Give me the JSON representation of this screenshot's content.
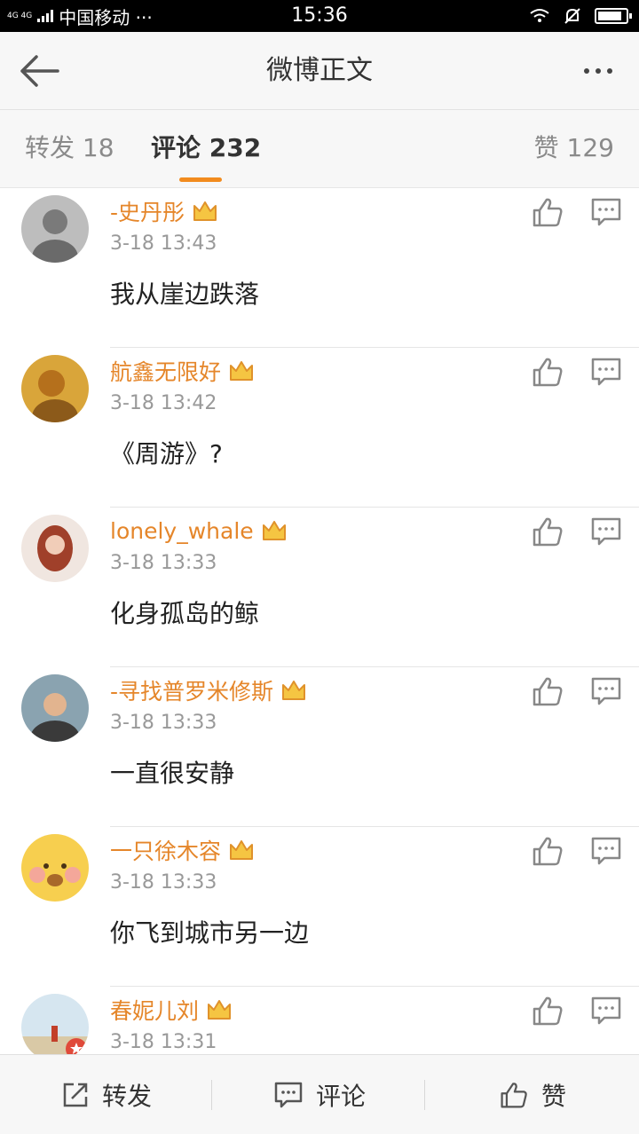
{
  "status_bar": {
    "network": "4G 4G",
    "carrier": "中国移动 ···",
    "time": "15:36",
    "battery_level": 0.85
  },
  "nav": {
    "title": "微博正文"
  },
  "tabs": {
    "repost": "转发 18",
    "comment": "评论 232",
    "like": "赞 129"
  },
  "comments": [
    {
      "user": "-史丹彤",
      "time": "3-18 13:43",
      "text": "我从崖边跌落",
      "avatar_icon": "user-avatar-icon"
    },
    {
      "user": "航鑫无限好",
      "time": "3-18 13:42",
      "text": "《周游》?",
      "avatar_icon": "user-avatar-icon"
    },
    {
      "user": "lonely_whale",
      "time": "3-18 13:33",
      "text": "化身孤岛的鲸",
      "avatar_icon": "user-avatar-icon"
    },
    {
      "user": "-寻找普罗米修斯",
      "time": "3-18 13:33",
      "text": "一直很安静",
      "avatar_icon": "user-avatar-icon"
    },
    {
      "user": "一只徐木容",
      "time": "3-18 13:33",
      "text": "你飞到城市另一边",
      "avatar_icon": "user-avatar-icon"
    },
    {
      "user": "春妮儿刘",
      "time": "3-18 13:31",
      "text": "",
      "avatar_icon": "user-avatar-icon"
    }
  ],
  "bottom_bar": {
    "repost": "转发",
    "comment": "评论",
    "like": "赞"
  },
  "colors": {
    "accent": "#f28b1e",
    "username": "#e5862a",
    "timestamp": "#999999"
  }
}
